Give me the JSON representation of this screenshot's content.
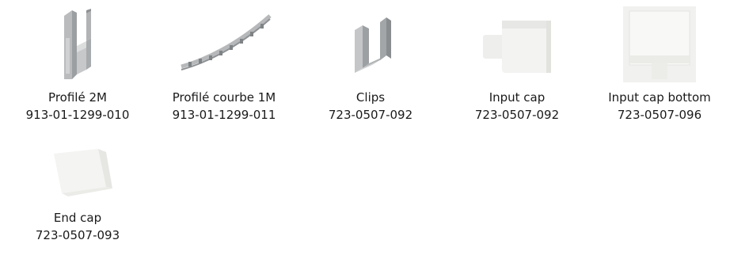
{
  "products": [
    {
      "name": "Profilé 2M",
      "ref": "913-01-1299-010",
      "icon": "aluminium-profile-image"
    },
    {
      "name": "Profilé courbe 1M",
      "ref": "913-01-1299-011",
      "icon": "curved-profile-image"
    },
    {
      "name": "Clips",
      "ref": "723-0507-092",
      "icon": "clip-image"
    },
    {
      "name": "Input cap",
      "ref": "723-0507-092",
      "icon": "input-cap-image"
    },
    {
      "name": "Input cap bottom",
      "ref": "723-0507-096",
      "icon": "input-cap-bottom-image"
    },
    {
      "name": "End cap",
      "ref": "723-0507-093",
      "icon": "end-cap-image"
    }
  ],
  "colors": {
    "text": "#1a1a1a",
    "aluminium": "#a9acae",
    "plastic": "#f2f2f0"
  }
}
